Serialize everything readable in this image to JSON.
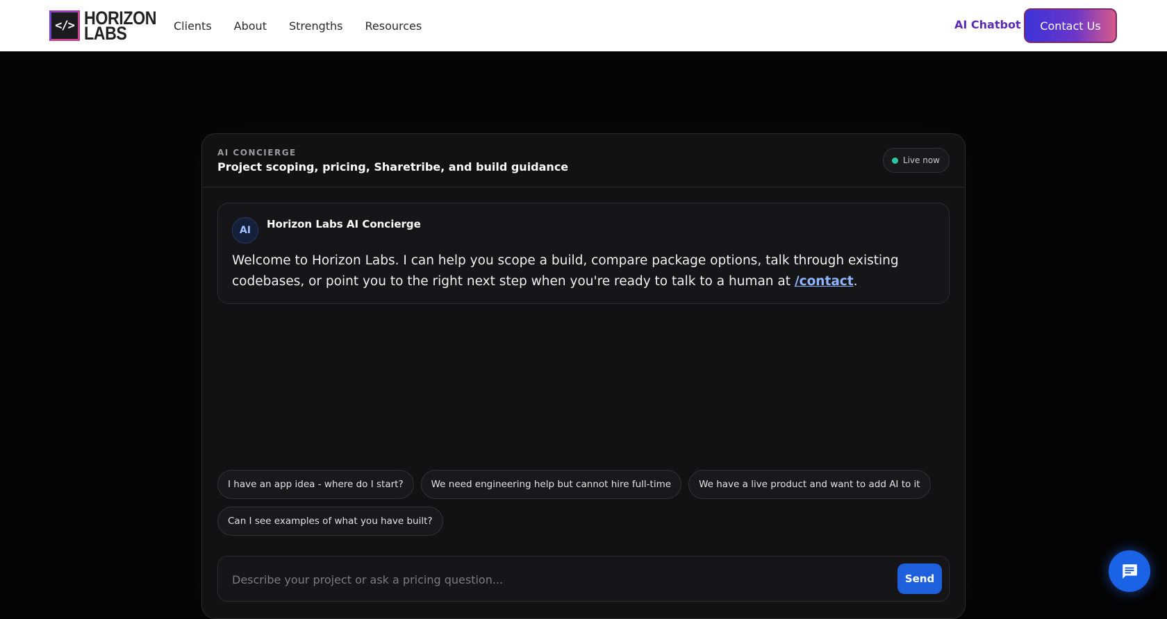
{
  "header": {
    "logo_line1": "HORIZON",
    "logo_line2": "LABS",
    "logo_mark": "</>",
    "nav": [
      "Clients",
      "About",
      "Strengths",
      "Resources"
    ],
    "ai_chatbot_label": "AI Chatbot",
    "contact_label": "Contact Us"
  },
  "panel": {
    "eyebrow": "AI CONCIERGE",
    "title": "Project scoping, pricing, Sharetribe, and build guidance",
    "status": "Live now",
    "status_color": "#2bc7a3"
  },
  "message": {
    "avatar": "AI",
    "sender": "Horizon Labs AI Concierge",
    "text_before": "Welcome to Horizon Labs. I can help you scope a build, compare package options, talk through existing codebases, or point you to the right next step when you're ready to talk to a human at ",
    "link": "/contact",
    "text_after": "."
  },
  "suggestions": [
    "I have an app idea - where do I start?",
    "We need engineering help but cannot hire full-time",
    "We have a live product and want to add AI to it",
    "Can I see examples of what you have built?"
  ],
  "composer": {
    "placeholder": "Describe your project or ask a pricing question...",
    "send_label": "Send"
  },
  "fab": {
    "icon": "chat-bubble-icon"
  },
  "colors": {
    "accent": "#1e5fdc",
    "brand": "#5b2bb8"
  }
}
